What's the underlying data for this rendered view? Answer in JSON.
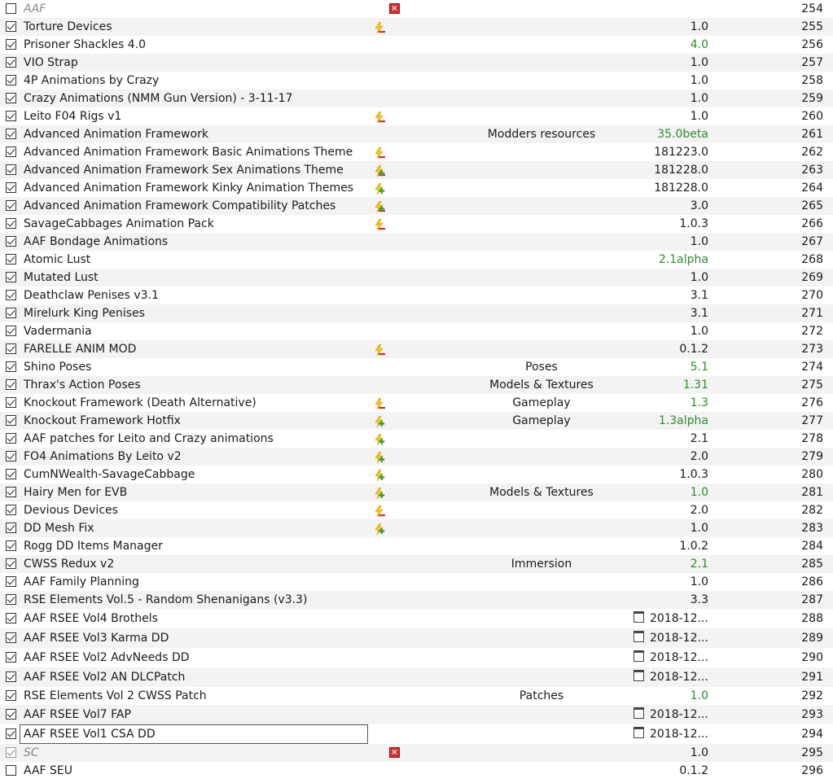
{
  "mods": [
    {
      "checked": false,
      "name": "AAF",
      "disabled": true,
      "flag": "",
      "missing": true,
      "category": "",
      "version": "",
      "date": "",
      "priority": "254"
    },
    {
      "checked": true,
      "name": "Torture Devices",
      "flag": "conflict-overwritten",
      "category": "",
      "version": "1.0",
      "priority": "255"
    },
    {
      "checked": true,
      "name": "Prisoner Shackles 4.0",
      "flag": "",
      "category": "",
      "version": "4.0",
      "version_green": true,
      "priority": "256"
    },
    {
      "checked": true,
      "name": "VIO Strap",
      "flag": "",
      "category": "",
      "version": "1.0",
      "priority": "257"
    },
    {
      "checked": true,
      "name": "4P Animations by Crazy",
      "flag": "",
      "category": "",
      "version": "1.0",
      "priority": "258"
    },
    {
      "checked": true,
      "name": "Crazy Animations (NMM Gun Version) - 3-11-17",
      "flag": "",
      "category": "",
      "version": "1.0",
      "priority": "259"
    },
    {
      "checked": true,
      "name": "Leito F04 Rigs v1",
      "flag": "conflict-overwritten",
      "category": "",
      "version": "1.0",
      "priority": "260"
    },
    {
      "checked": true,
      "name": "Advanced Animation Framework",
      "flag": "",
      "category": "Modders resources",
      "version": "35.0beta",
      "version_green": true,
      "priority": "261"
    },
    {
      "checked": true,
      "name": "Advanced Animation Framework Basic Animations Theme",
      "flag": "conflict-overwritten",
      "category": "",
      "version": "181223.0",
      "priority": "262"
    },
    {
      "checked": true,
      "name": "Advanced Animation Framework Sex Animations Theme",
      "flag": "conflict-mixed",
      "category": "",
      "version": "181228.0",
      "priority": "263"
    },
    {
      "checked": true,
      "name": "Advanced Animation Framework Kinky Animation Themes",
      "flag": "conflict-overwrite",
      "category": "",
      "version": "181228.0",
      "priority": "264"
    },
    {
      "checked": true,
      "name": "Advanced Animation Framework Compatibility Patches",
      "flag": "conflict-mixed",
      "category": "",
      "version": "3.0",
      "priority": "265"
    },
    {
      "checked": true,
      "name": "SavageCabbages Animation Pack",
      "flag": "conflict-overwritten",
      "category": "",
      "version": "1.0.3",
      "priority": "266"
    },
    {
      "checked": true,
      "name": "AAF Bondage Animations",
      "flag": "",
      "category": "",
      "version": "1.0",
      "priority": "267"
    },
    {
      "checked": true,
      "name": "Atomic Lust",
      "flag": "",
      "category": "",
      "version": "2.1alpha",
      "version_green": true,
      "priority": "268"
    },
    {
      "checked": true,
      "name": "Mutated Lust",
      "flag": "",
      "category": "",
      "version": "1.0",
      "priority": "269"
    },
    {
      "checked": true,
      "name": "Deathclaw Penises v3.1",
      "flag": "",
      "category": "",
      "version": "3.1",
      "priority": "270"
    },
    {
      "checked": true,
      "name": "Mirelurk King Penises",
      "flag": "",
      "category": "",
      "version": "3.1",
      "priority": "271"
    },
    {
      "checked": true,
      "name": "Vadermania",
      "flag": "",
      "category": "",
      "version": "1.0",
      "priority": "272"
    },
    {
      "checked": true,
      "name": "FARELLE ANIM MOD",
      "flag": "conflict-overwritten",
      "category": "",
      "version": "0.1.2",
      "priority": "273"
    },
    {
      "checked": true,
      "name": "Shino Poses",
      "flag": "",
      "category": "Poses",
      "version": "5.1",
      "version_green": true,
      "priority": "274"
    },
    {
      "checked": true,
      "name": "Thrax's Action Poses",
      "flag": "",
      "category": "Models & Textures",
      "version": "1.31",
      "version_green": true,
      "priority": "275"
    },
    {
      "checked": true,
      "name": "Knockout Framework (Death Alternative)",
      "flag": "conflict-overwritten",
      "category": "Gameplay",
      "version": "1.3",
      "version_green": true,
      "priority": "276"
    },
    {
      "checked": true,
      "name": "Knockout Framework Hotfix",
      "flag": "conflict-overwrite",
      "category": "Gameplay",
      "version": "1.3alpha",
      "version_green": true,
      "priority": "277"
    },
    {
      "checked": true,
      "name": "AAF patches for Leito and Crazy animations",
      "flag": "conflict-overwrite",
      "category": "",
      "version": "2.1",
      "priority": "278"
    },
    {
      "checked": true,
      "name": "FO4 Animations By Leito v2",
      "flag": "conflict-overwrite",
      "category": "",
      "version": "2.0",
      "priority": "279"
    },
    {
      "checked": true,
      "name": "CumNWealth-SavageCabbage",
      "flag": "conflict-overwrite",
      "category": "",
      "version": "1.0.3",
      "priority": "280"
    },
    {
      "checked": true,
      "name": "Hairy Men for EVB",
      "flag": "conflict-overwrite",
      "category": "Models & Textures",
      "version": "1.0",
      "version_green": true,
      "priority": "281"
    },
    {
      "checked": true,
      "name": "Devious Devices",
      "flag": "conflict-overwritten",
      "category": "",
      "version": "2.0",
      "priority": "282"
    },
    {
      "checked": true,
      "name": "DD Mesh Fix",
      "flag": "conflict-overwrite",
      "category": "",
      "version": "1.0",
      "priority": "283"
    },
    {
      "checked": true,
      "name": "Rogg DD Items Manager",
      "flag": "",
      "category": "",
      "version": "1.0.2",
      "priority": "284"
    },
    {
      "checked": true,
      "name": "CWSS Redux v2",
      "flag": "",
      "category": "Immersion",
      "version": "2.1",
      "version_green": true,
      "priority": "285"
    },
    {
      "checked": true,
      "name": "AAF Family Planning",
      "flag": "",
      "category": "",
      "version": "1.0",
      "priority": "286"
    },
    {
      "checked": true,
      "name": "RSE Elements Vol.5 - Random Shenanigans (v3.3)",
      "flag": "",
      "category": "",
      "version": "3.3",
      "priority": "287"
    },
    {
      "checked": true,
      "name": "AAF RSEE Vol4 Brothels",
      "flag": "",
      "category": "",
      "version": "",
      "date": "2018-12...",
      "tall": true,
      "priority": "288"
    },
    {
      "checked": true,
      "name": "AAF RSEE Vol3 Karma DD",
      "flag": "",
      "category": "",
      "version": "",
      "date": "2018-12...",
      "tall": true,
      "priority": "289"
    },
    {
      "checked": true,
      "name": "AAF RSEE Vol2 AdvNeeds DD",
      "flag": "",
      "category": "",
      "version": "",
      "date": "2018-12...",
      "tall": true,
      "priority": "290"
    },
    {
      "checked": true,
      "name": "AAF RSEE Vol2 AN DLCPatch",
      "flag": "",
      "category": "",
      "version": "",
      "date": "2018-12...",
      "tall": true,
      "priority": "291"
    },
    {
      "checked": true,
      "name": "RSE Elements Vol 2 CWSS Patch",
      "flag": "",
      "category": "Patches",
      "version": "1.0",
      "version_green": true,
      "priority": "292"
    },
    {
      "checked": true,
      "name": "AAF RSEE Vol7 FAP",
      "flag": "",
      "category": "",
      "version": "",
      "date": "2018-12...",
      "tall": true,
      "priority": "293"
    },
    {
      "checked": true,
      "name": "AAF RSEE Vol1 CSA DD",
      "flag": "",
      "category": "",
      "version": "",
      "date": "2018-12...",
      "tall": true,
      "focused": true,
      "priority": "294"
    },
    {
      "checked": true,
      "name": "SC",
      "disabled": true,
      "greyed_check": true,
      "flag": "",
      "missing": true,
      "category": "",
      "version": "1.0",
      "priority": "295"
    },
    {
      "checked": false,
      "name": "AAF SEU",
      "flag": "",
      "category": "",
      "version": "0.1.2",
      "priority": "296"
    }
  ]
}
